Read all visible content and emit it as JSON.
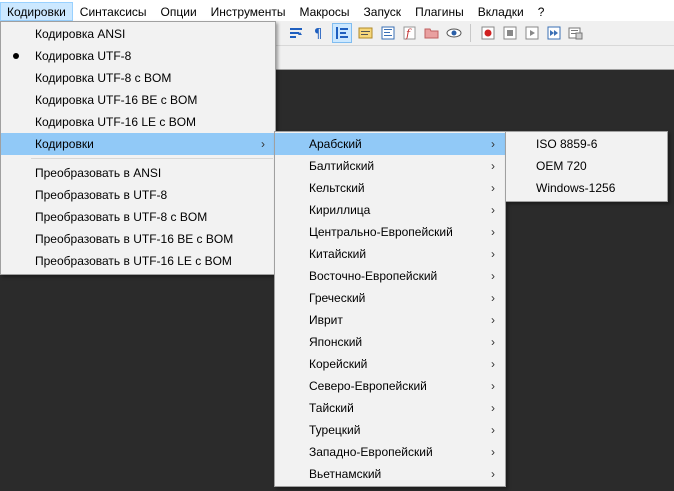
{
  "menubar": {
    "items": [
      "Кодировки",
      "Синтаксисы",
      "Опции",
      "Инструменты",
      "Макросы",
      "Запуск",
      "Плагины",
      "Вкладки",
      "?"
    ]
  },
  "encoding_menu": {
    "group1": [
      "Кодировка ANSI",
      "Кодировка UTF-8",
      "Кодировка UTF-8 с BOM",
      "Кодировка UTF-16 BE с BOM",
      "Кодировка UTF-16 LE с BOM"
    ],
    "selected": "Кодировка UTF-8",
    "submenu_label": "Кодировки",
    "group2": [
      "Преобразовать в ANSI",
      "Преобразовать в UTF-8",
      "Преобразовать в UTF-8 с BOM",
      "Преобразовать в UTF-16 BE с BOM",
      "Преобразовать в UTF-16 LE с BOM"
    ]
  },
  "charsets_menu": {
    "items": [
      "Арабский",
      "Балтийский",
      "Кельтский",
      "Кириллица",
      "Центрально-Европейский",
      "Китайский",
      "Восточно-Европейский",
      "Греческий",
      "Иврит",
      "Японский",
      "Корейский",
      "Северо-Европейский",
      "Тайский",
      "Турецкий",
      "Западно-Европейский",
      "Вьетнамский"
    ],
    "highlighted": "Арабский"
  },
  "arabic_menu": {
    "items": [
      "ISO 8859-6",
      "OEM 720",
      "Windows-1256"
    ]
  },
  "colors": {
    "highlight": "#91c9f7",
    "menubar_active": "#cce8ff",
    "editor_bg": "#2b2b2b"
  }
}
